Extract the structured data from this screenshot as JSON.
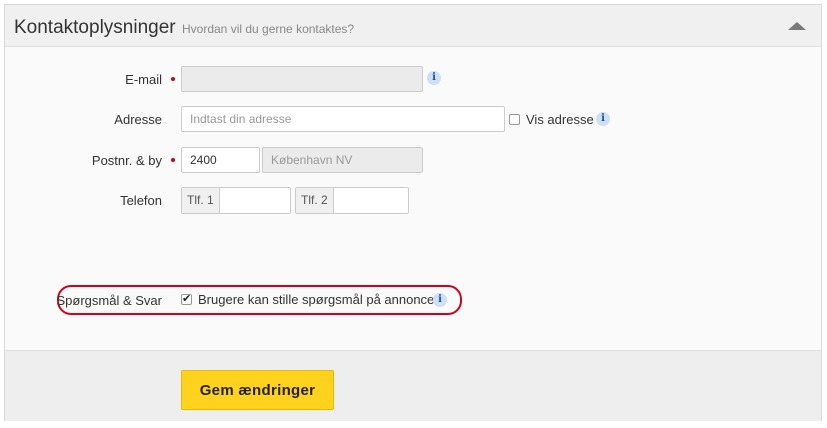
{
  "header": {
    "title": "Kontaktoplysninger",
    "subtitle": "Hvordan vil du gerne kontaktes?"
  },
  "form": {
    "email": {
      "label": "E-mail",
      "value": ""
    },
    "address": {
      "label": "Adresse",
      "placeholder": "Indtast din adresse",
      "show_label": "Vis adresse",
      "show_checked": false
    },
    "postal": {
      "label": "Postnr. & by",
      "zip": "2400",
      "city": "København NV"
    },
    "phone": {
      "label": "Telefon",
      "tlf1": "Tlf. 1",
      "tlf2": "Tlf. 2"
    },
    "qa": {
      "label": "Spørgsmål & Svar",
      "checkbox_label": "Brugere kan stille spørgsmål på annoncen",
      "checked": true
    }
  },
  "footer": {
    "save_label": "Gem ændringer"
  },
  "icons": {
    "info": "i",
    "collapse": "chevron-up-icon"
  },
  "colors": {
    "accent": "#ffd21e",
    "required": "#d0021b",
    "highlight": "#d0021b",
    "info_bg": "#cfe0f5"
  }
}
